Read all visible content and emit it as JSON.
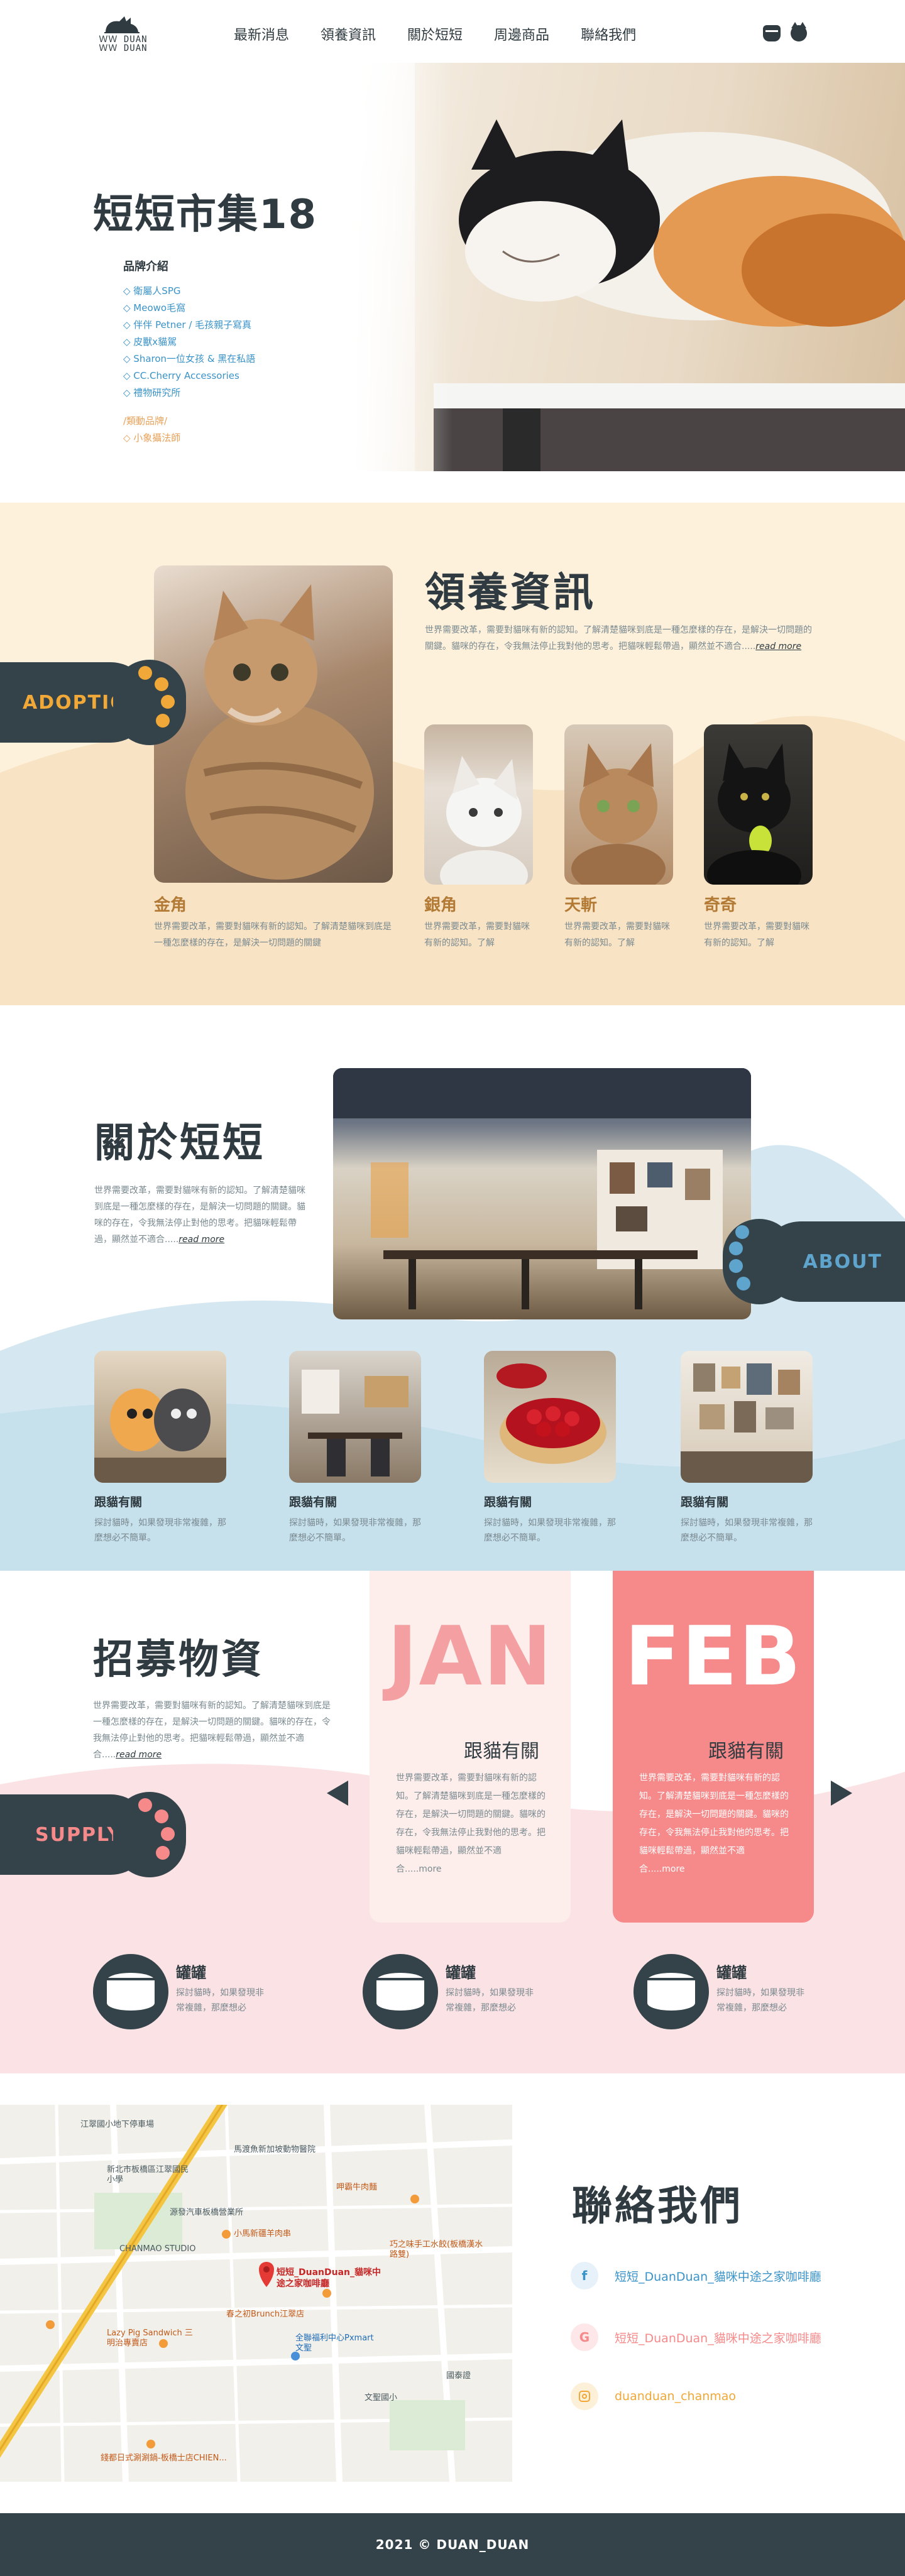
{
  "header": {
    "logo_text_top": "ＷＷ DUAN",
    "logo_text_bottom": "ＷＷ DUAN",
    "nav": [
      "最新消息",
      "領養資訊",
      "關於短短",
      "周邊商品",
      "聯絡我們"
    ]
  },
  "hero": {
    "title": "短短市集18",
    "brand_title": "品牌介紹",
    "brands": [
      "◇ 衛屬人SPG",
      "◇ Meowo毛窩",
      "◇ 伴伴 Petner / 毛孩親子寫真",
      "◇ 皮獸x貓駕",
      "◇ Sharon一位女孩 & 黑在私語",
      "◇ CC.Cherry Accessories",
      "◇ 禮物研究所"
    ],
    "sub_title": "/類動品牌/",
    "sub_item": "◇ 小象攝法師",
    "active_slide": 2
  },
  "adoption": {
    "tab_label": "ADOPTION",
    "title": "領養資訊",
    "intro": "世界需要改革，需要對貓咪有新的認知。了解清楚貓咪到底是一種怎麼樣的存在，是解決一切問題的關鍵。貓咪的存在，令我無法停止我對他的思考。把貓咪輕鬆帶過，顯然並不適合.....",
    "more": "read more",
    "cats": [
      {
        "name": "金角",
        "desc": "世界需要改革，需要對貓咪有新的認知。了解清楚貓咪到底是一種怎麼樣的存在，是解決一切問題的關鍵"
      },
      {
        "name": "銀角",
        "desc": "世界需要改革，需要對貓咪有新的認知。了解"
      },
      {
        "name": "天斬",
        "desc": "世界需要改革，需要對貓咪有新的認知。了解"
      },
      {
        "name": "奇奇",
        "desc": "世界需要改革，需要對貓咪有新的認知。了解"
      }
    ]
  },
  "about": {
    "tab_label": "ABOUT",
    "title": "關於短短",
    "intro": "世界需要改革，需要對貓咪有新的認知。了解清楚貓咪到底是一種怎麼樣的存在，是解決一切問題的關鍵。貓咪的存在，令我無法停止對他的思考。把貓咪輕鬆帶過，顯然並不適合.....",
    "more": "read more",
    "cards": [
      {
        "title": "跟貓有關",
        "desc": "探討貓時，如果發現非常複雜，那麼想必不簡單。"
      },
      {
        "title": "跟貓有關",
        "desc": "探討貓時，如果發現非常複雜，那麼想必不簡單。"
      },
      {
        "title": "跟貓有關",
        "desc": "探討貓時，如果發現非常複雜，那麼想必不簡單。"
      },
      {
        "title": "跟貓有關",
        "desc": "探討貓時，如果發現非常複雜，那麼想必不簡單。"
      }
    ]
  },
  "supply": {
    "tab_label": "SUPPLY",
    "title": "招募物資",
    "intro": "世界需要改革，需要對貓咪有新的認知。了解清楚貓咪到底是一種怎麼樣的存在，是解決一切問題的關鍵。貓咪的存在，令我無法停止對他的思考。把貓咪輕鬆帶過，顯然並不適合.....",
    "more": "read more",
    "months": [
      {
        "month": "JAN",
        "sub": "跟貓有關",
        "text": "世界需要改革，需要對貓咪有新的認知。了解清楚貓咪到底是一種怎麼樣的存在，是解決一切問題的關鍵。貓咪的存在，令我無法停止我對他的思考。把貓咪輕鬆帶過，顯然並不適合.....",
        "more": "more"
      },
      {
        "month": "FEB",
        "sub": "跟貓有關",
        "text": "世界需要改革，需要對貓咪有新的認知。了解清楚貓咪到底是一種怎麼樣的存在，是解決一切問題的關鍵。貓咪的存在，令我無法停止我對他的思考。把貓咪輕鬆帶過，顯然並不適合.....",
        "more": "more"
      }
    ],
    "items": [
      {
        "title": "罐罐",
        "desc": "探討貓時，如果發現非常複雜，那麼想必"
      },
      {
        "title": "罐罐",
        "desc": "探討貓時，如果發現非常複雜，那麼想必"
      },
      {
        "title": "罐罐",
        "desc": "探討貓時，如果發現非常複雜，那麼想必"
      }
    ]
  },
  "contact": {
    "title": "聯絡我們",
    "facebook": "短短_DuanDuan_貓咪中途之家咖啡廳",
    "google": "短短_DuanDuan_貓咪中途之家咖啡廳",
    "instagram": "duanduan_chanmao",
    "map_labels": {
      "pin": "短短_DuanDuan_貓咪中途之家咖啡廳",
      "l1": "江翠國小地下停車場",
      "l2": "新北市板橋區江翠國民小學",
      "l3": "源發汽車板橋營業所",
      "l4": "CHANMAO STUDIO",
      "l5": "小馬新疆羊肉串",
      "l6": "巧之味手工水餃(板橋漢水路雙)",
      "l7": "馬渡魚新加坡動物醫院",
      "l8": "呷霸牛肉麵",
      "l9": "春之初Brunch江翠店",
      "l10": "全聯福利中心Pxmart 文聖",
      "l11": "Lazy Pig Sandwich 三明治專賣店",
      "l12": "文聖國小",
      "l13": "國泰證",
      "l14": "錢都日式涮涮鍋-板橋士店CHIEN..."
    }
  },
  "footer": {
    "text": "2021 © DUAN_DUAN"
  },
  "colors": {
    "dark": "#34434a",
    "orange_accent": "#f0a838",
    "blue_accent": "#3a93c8",
    "pink_accent": "#f6898a",
    "cream": "#fdf1dc",
    "light_blue": "#d5e8f1",
    "light_pink": "#fbe2e4"
  }
}
